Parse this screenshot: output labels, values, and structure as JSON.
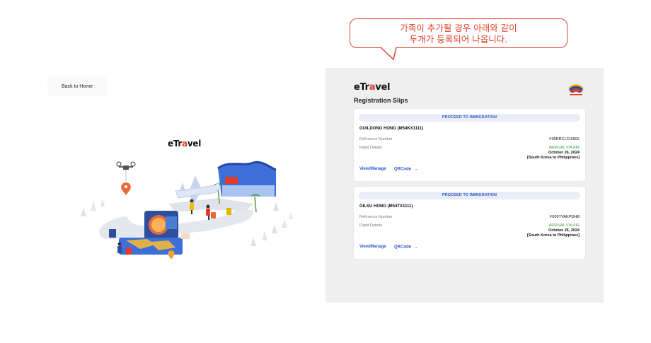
{
  "annotation": {
    "line1": "가족이 추가될 경우 아래와 같이",
    "line2": "두개가 등록되어 나옵니다."
  },
  "left": {
    "back_label": "Back to Home",
    "logo_prefix": "eTr",
    "logo_accent": "a",
    "logo_suffix": "vel"
  },
  "panel": {
    "logo_prefix": "eTr",
    "logo_accent": "a",
    "logo_suffix": "vel",
    "title": "Registration Slips",
    "seal_icon": "philippines-seal-icon"
  },
  "slips": [
    {
      "status": "PROCEED TO IMMIGRATION",
      "name": "GUILDONG HONG (M54KX1111)",
      "ref_label": "Reference Number",
      "ref_value": "F00RRCLCH3EE",
      "flight_label": "Flight Details",
      "arrival": "ARRIVAL VIA AIR",
      "date": "October 26, 2024",
      "route": "[South Korea to Philippines]",
      "view_label": "View/Manage",
      "qr_label": "QRCode"
    },
    {
      "status": "PROCEED TO IMMIGRATION",
      "name": "GILSU HONG (M54TX1111)",
      "ref_label": "Reference Number",
      "ref_value": "F009YVAKPDHB",
      "flight_label": "Flight Details",
      "arrival": "ARRIVAL VIA AIR",
      "date": "October 26, 2024",
      "route": "[South Korea to Philippines]",
      "view_label": "View/Manage",
      "qr_label": "QRCode"
    }
  ],
  "colors": {
    "accent_blue": "#2c57c9",
    "arrival_green": "#3aa64a",
    "annotation_red": "#e2412c",
    "panel_bg": "#efefef"
  }
}
